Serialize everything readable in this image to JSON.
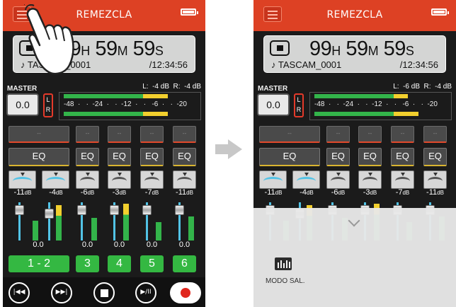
{
  "left_screen": {
    "title": "REMEZCLA",
    "counter": {
      "hours": "99",
      "h_unit": "H",
      "minutes": "59",
      "m_unit": "M",
      "seconds": "59",
      "s_unit": "S",
      "file_name": "♪ TASCAM_0001",
      "remaining": "/12:34:56"
    },
    "master": {
      "label": "MASTER",
      "value": "0.0",
      "lr": "L\nR",
      "levels": "L:  -4 dB  R:  -4 dB",
      "scale": "-48  ·   ·  -24  ·   ·  -12  ·   ·   -6  ·   ·  -20"
    },
    "channel_blank_label": "--",
    "eq_label": "EQ",
    "gains": [
      {
        "value": "-11",
        "unit": "dB"
      },
      {
        "value": "-4",
        "unit": "dB"
      },
      {
        "value": "-6",
        "unit": "dB"
      },
      {
        "value": "-3",
        "unit": "dB"
      },
      {
        "value": "-7",
        "unit": "dB"
      },
      {
        "value": "-11",
        "unit": "dB"
      }
    ],
    "fader_value": "0.0",
    "channel_numbers": [
      "1  -  2",
      "3",
      "4",
      "5",
      "6"
    ],
    "transport_icons": [
      "rewind-icon",
      "fast-forward-icon",
      "stop-icon",
      "play-pause-icon",
      "record-icon"
    ],
    "transport_glyphs": [
      "|◀◀",
      "▶▶|",
      "",
      "▶/II",
      ""
    ]
  },
  "right_screen": {
    "title": "REMEZCLA",
    "counter": {
      "hours": "99",
      "h_unit": "H",
      "minutes": "59",
      "m_unit": "M",
      "seconds": "59",
      "s_unit": "S",
      "file_name": "♪ TASCAM_0001",
      "remaining": "/12:34:56"
    },
    "master": {
      "label": "MASTER",
      "value": "0.0",
      "lr": "L\nR",
      "levels": "L:  -6 dB  R:  -4 dB",
      "scale": "-48  ·   ·  -24  ·   ·  -12  ·   ·   -6  ·   ·  -20"
    },
    "channel_blank_label": "--",
    "eq_label": "EQ",
    "gains": [
      {
        "value": "-11",
        "unit": "dB"
      },
      {
        "value": "-4",
        "unit": "dB"
      },
      {
        "value": "-6",
        "unit": "dB"
      },
      {
        "value": "-3",
        "unit": "dB"
      },
      {
        "value": "-7",
        "unit": "dB"
      },
      {
        "value": "-11",
        "unit": "dB"
      }
    ],
    "overlay_option": "MODO SAL."
  },
  "colors": {
    "header": "#dd4124",
    "accent_green": "#34b842",
    "eq_underline": "#d9b430",
    "pan_blue": "#52c3e6"
  }
}
